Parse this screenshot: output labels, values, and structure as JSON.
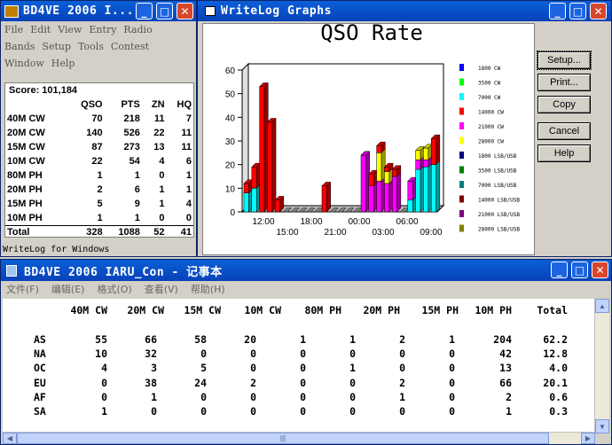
{
  "score_window": {
    "title": "BD4VE 2006 I...",
    "menu": [
      "File",
      "Edit",
      "View",
      "Entry",
      "Radio",
      "Bands",
      "Setup",
      "Tools",
      "Contest",
      "Window",
      "Help"
    ],
    "score_label": "Score: 101,184",
    "headers": [
      "",
      "QSO",
      "PTS",
      "ZN",
      "HQ"
    ],
    "rows": [
      [
        "40M CW",
        "70",
        "218",
        "11",
        "7"
      ],
      [
        "20M CW",
        "140",
        "526",
        "22",
        "11"
      ],
      [
        "15M CW",
        "87",
        "273",
        "13",
        "11"
      ],
      [
        "10M CW",
        "22",
        "54",
        "4",
        "6"
      ],
      [
        "80M PH",
        "1",
        "1",
        "0",
        "1"
      ],
      [
        "20M PH",
        "2",
        "6",
        "1",
        "1"
      ],
      [
        "15M PH",
        "5",
        "9",
        "1",
        "4"
      ],
      [
        "10M PH",
        "1",
        "1",
        "0",
        "0"
      ],
      [
        "Total",
        "328",
        "1088",
        "52",
        "41"
      ]
    ],
    "status": "WriteLog for Windows"
  },
  "graph_window": {
    "title": "WriteLog Graphs",
    "buttons": [
      "Setup...",
      "Print...",
      "Copy",
      "Cancel",
      "Help"
    ],
    "chart_data": {
      "type": "bar",
      "title": "QSO Rate",
      "ylim": [
        0,
        60
      ],
      "yticks": [
        "60",
        "50",
        "40",
        "30",
        "20",
        "10",
        "0"
      ],
      "xticks_top": [
        "12:00",
        "18:00",
        "00:00",
        "06:00"
      ],
      "xticks_bottom": [
        "15:00",
        "21:00",
        "03:00",
        "09:00"
      ],
      "legend": [
        {
          "label": "1800 CW",
          "color": "#0000ff"
        },
        {
          "label": "3500 CW",
          "color": "#00ff00"
        },
        {
          "label": "7000 CW",
          "color": "#00ffff"
        },
        {
          "label": "14000 CW",
          "color": "#ff0000"
        },
        {
          "label": "21000 CW",
          "color": "#ff00ff"
        },
        {
          "label": "28000 CW",
          "color": "#ffff00"
        },
        {
          "label": "1800 LSB/USB",
          "color": "#000080"
        },
        {
          "label": "3500 LSB/USB",
          "color": "#008000"
        },
        {
          "label": "7000 LSB/USB",
          "color": "#008080"
        },
        {
          "label": "14000 LSB/USB",
          "color": "#800000"
        },
        {
          "label": "21000 LSB/USB",
          "color": "#800080"
        },
        {
          "label": "28000 LSB/USB",
          "color": "#808000"
        }
      ],
      "stacks": [
        [
          [
            "#00ffff",
            8
          ],
          [
            "#ff0000",
            4
          ]
        ],
        [
          [
            "#00ffff",
            10
          ],
          [
            "#ff0000",
            9
          ]
        ],
        [
          [
            "#ff0000",
            53
          ]
        ],
        [
          [
            "#ff0000",
            38
          ]
        ],
        [
          [
            "#ff0000",
            5
          ]
        ],
        [],
        [],
        [],
        [],
        [],
        [
          [
            "#ff0000",
            11
          ]
        ],
        [],
        [],
        [],
        [],
        [
          [
            "#ff00ff",
            24
          ]
        ],
        [
          [
            "#ff00ff",
            11
          ],
          [
            "#ff0000",
            5
          ]
        ],
        [
          [
            "#ff00ff",
            13
          ],
          [
            "#ffff00",
            12
          ],
          [
            "#ff0000",
            3
          ]
        ],
        [
          [
            "#ff00ff",
            12
          ],
          [
            "#ffff00",
            5
          ],
          [
            "#ff0000",
            2
          ]
        ],
        [
          [
            "#ff00ff",
            15
          ],
          [
            "#ff0000",
            3
          ]
        ],
        [],
        [
          [
            "#00ffff",
            5
          ],
          [
            "#ff00ff",
            8
          ]
        ],
        [
          [
            "#00ffff",
            18
          ],
          [
            "#ff00ff",
            4
          ],
          [
            "#ffff00",
            4
          ]
        ],
        [
          [
            "#00ffff",
            19
          ],
          [
            "#ff00ff",
            3
          ],
          [
            "#ffff00",
            5
          ]
        ],
        [
          [
            "#00ffff",
            20
          ],
          [
            "#ff0000",
            11
          ]
        ]
      ]
    }
  },
  "notepad_window": {
    "title": "BD4VE 2006 IARU_Con - 记事本",
    "menu": [
      "文件(F)",
      "编辑(E)",
      "格式(O)",
      "查看(V)",
      "帮助(H)"
    ],
    "columns": [
      "",
      "40M CW",
      "20M CW",
      "15M CW",
      "10M CW",
      "80M PH",
      "20M PH",
      "15M PH",
      "10M PH",
      "Total"
    ],
    "rows": [
      [
        "AS",
        "55",
        "66",
        "58",
        "20",
        "1",
        "1",
        "2",
        "1",
        "204",
        "62.2"
      ],
      [
        "NA",
        "10",
        "32",
        "0",
        "0",
        "0",
        "0",
        "0",
        "0",
        "42",
        "12.8"
      ],
      [
        "OC",
        "4",
        "3",
        "5",
        "0",
        "0",
        "1",
        "0",
        "0",
        "13",
        "4.0"
      ],
      [
        "EU",
        "0",
        "38",
        "24",
        "2",
        "0",
        "0",
        "2",
        "0",
        "66",
        "20.1"
      ],
      [
        "AF",
        "0",
        "1",
        "0",
        "0",
        "0",
        "0",
        "1",
        "0",
        "2",
        "0.6"
      ],
      [
        "SA",
        "1",
        "0",
        "0",
        "0",
        "0",
        "0",
        "0",
        "0",
        "1",
        "0.3"
      ]
    ]
  }
}
